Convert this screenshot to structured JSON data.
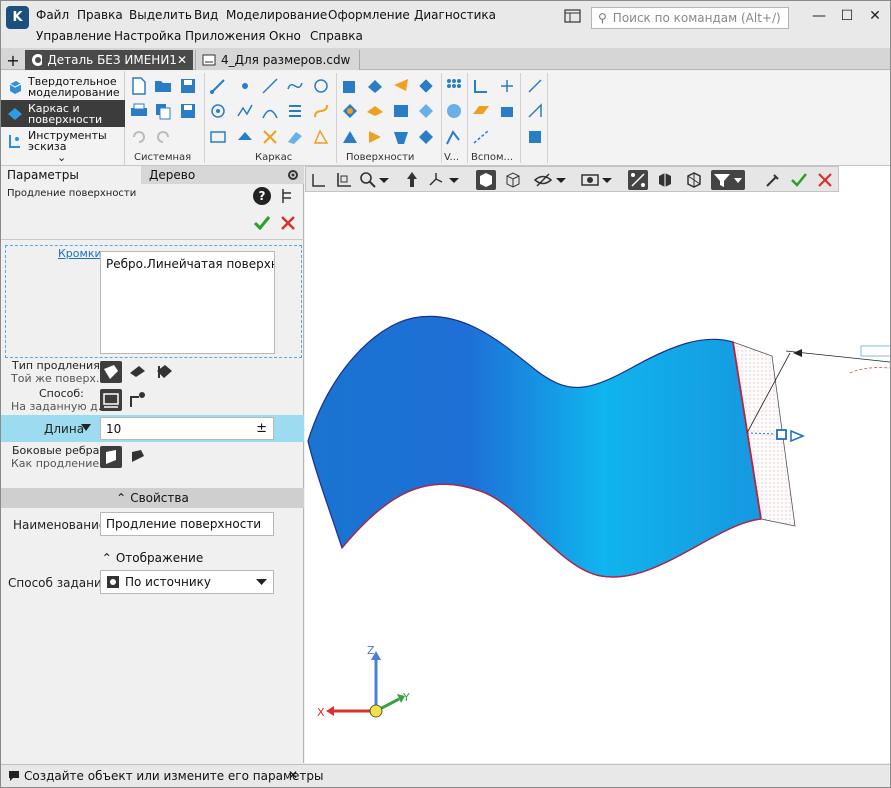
{
  "app": {
    "menu_row1": [
      "Файл",
      "Правка",
      "Выделить",
      "Вид",
      "Моделирование",
      "Оформление",
      "Диагностика"
    ],
    "menu_row2": [
      "Управление",
      "Настройка",
      "Приложения",
      "Окно",
      "Справка"
    ],
    "search_placeholder": "Поиск по командам (Alt+/)",
    "window_buttons": [
      "—",
      "☐",
      "✕"
    ]
  },
  "tabs": [
    {
      "label": "Деталь БЕЗ ИМЕНИ1",
      "close": "✕",
      "active": true
    },
    {
      "label": "4_Для размеров.cdw",
      "active": false
    }
  ],
  "add_tab": "+",
  "ribbon": {
    "categories": [
      {
        "label": "Твердотельное моделирование",
        "icon": "solid-cube-icon",
        "selected": false
      },
      {
        "label": "Каркас и поверхности",
        "icon": "wireframe-surface-icon",
        "selected": true
      },
      {
        "label": "Инструменты эскиза",
        "icon": "sketch-tools-icon",
        "selected": false
      }
    ],
    "expand_glyph": "⌄",
    "groups": [
      "Системная",
      "Каркас",
      "Поверхности",
      "V...",
      "Вспом..."
    ]
  },
  "panel": {
    "tabs": [
      "Параметры",
      "Дерево"
    ],
    "title": "Продление поверхности",
    "help": "?",
    "edges_label": "Кромки",
    "edges_value": "Ребро.Линейчатая поверхно...",
    "extension_type_label": "Тип продления:",
    "extension_type_value": "Той же поверх...",
    "method_label": "Способ:",
    "method_value": "На заданную д...",
    "length_label": "Длина",
    "length_value": "10",
    "plusminus": "±",
    "side_edges_label": "Боковые ребра:",
    "side_edges_value": "Как продление...",
    "properties_section": "Свойства",
    "name_label": "Наименование:",
    "name_value": "Продление поверхности",
    "display_section": "Отображение",
    "set_method_label": "Способ задания:",
    "set_method_value": "По источнику"
  },
  "axes": {
    "x": "X",
    "y": "Y",
    "z": "Z"
  },
  "status": {
    "text": "Создайте объект или измените его параметры",
    "close": "✕"
  },
  "colors": {
    "accent_blue": "#1f8ad6",
    "surface_blue": "#10a8e8",
    "ok_green": "#2aa02a",
    "cancel_red": "#d83030",
    "length_row": "#9ddcf0"
  }
}
